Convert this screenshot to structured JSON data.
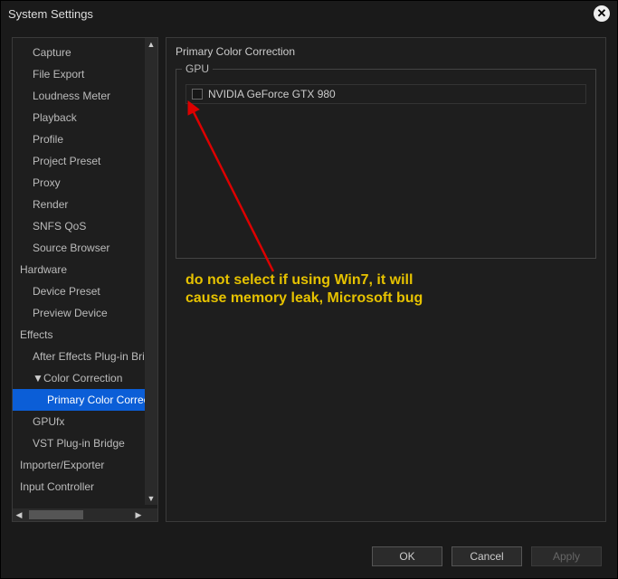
{
  "window": {
    "title": "System Settings"
  },
  "sidebar": {
    "items": [
      {
        "label": "Capture",
        "level": 1
      },
      {
        "label": "File Export",
        "level": 1
      },
      {
        "label": "Loudness Meter",
        "level": 1
      },
      {
        "label": "Playback",
        "level": 1
      },
      {
        "label": "Profile",
        "level": 1
      },
      {
        "label": "Project Preset",
        "level": 1
      },
      {
        "label": "Proxy",
        "level": 1
      },
      {
        "label": "Render",
        "level": 1
      },
      {
        "label": "SNFS QoS",
        "level": 1
      },
      {
        "label": "Source Browser",
        "level": 1
      },
      {
        "label": "Hardware",
        "level": 0
      },
      {
        "label": "Device Preset",
        "level": 1
      },
      {
        "label": "Preview Device",
        "level": 1
      },
      {
        "label": "Effects",
        "level": 0
      },
      {
        "label": "After Effects Plug-in Bridge",
        "level": 1
      },
      {
        "label": "Color Correction",
        "level": 1,
        "expanded": true
      },
      {
        "label": "Primary Color Correction",
        "level": 2,
        "selected": true
      },
      {
        "label": "GPUfx",
        "level": 1
      },
      {
        "label": "VST Plug-in Bridge",
        "level": 1
      },
      {
        "label": "Importer/Exporter",
        "level": 0
      },
      {
        "label": "Input Controller",
        "level": 0
      }
    ]
  },
  "main": {
    "panel_title": "Primary Color Correction",
    "gpu_group_label": "GPU",
    "gpu_items": [
      {
        "name": "NVIDIA GeForce GTX 980",
        "checked": false
      }
    ]
  },
  "annotation": {
    "line1": "do not select if using Win7, it will",
    "line2": "cause memory leak, Microsoft bug"
  },
  "buttons": {
    "ok": "OK",
    "cancel": "Cancel",
    "apply": "Apply"
  }
}
